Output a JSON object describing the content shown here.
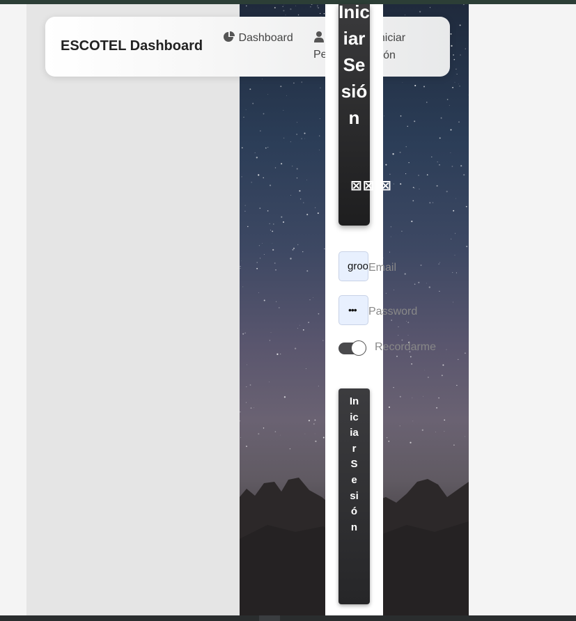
{
  "navbar": {
    "brand": "ESCOTEL Dashboard",
    "items": [
      {
        "icon": "chart-pie-icon",
        "label": "Dashboard"
      },
      {
        "icon": "user-icon",
        "label": "Perfil"
      },
      {
        "icon": "key-icon",
        "label": "Iniciar Sesión"
      }
    ]
  },
  "login": {
    "title": "Iniciar Sesión",
    "header_icons": "⊠⊠ ⊠",
    "email": {
      "value": "groot@escotel.com",
      "label": "Email"
    },
    "password": {
      "value": "•••",
      "label": "Password"
    },
    "remember": {
      "label": "Recordarme",
      "checked": true
    },
    "submit_label": "IniciarSesión"
  }
}
